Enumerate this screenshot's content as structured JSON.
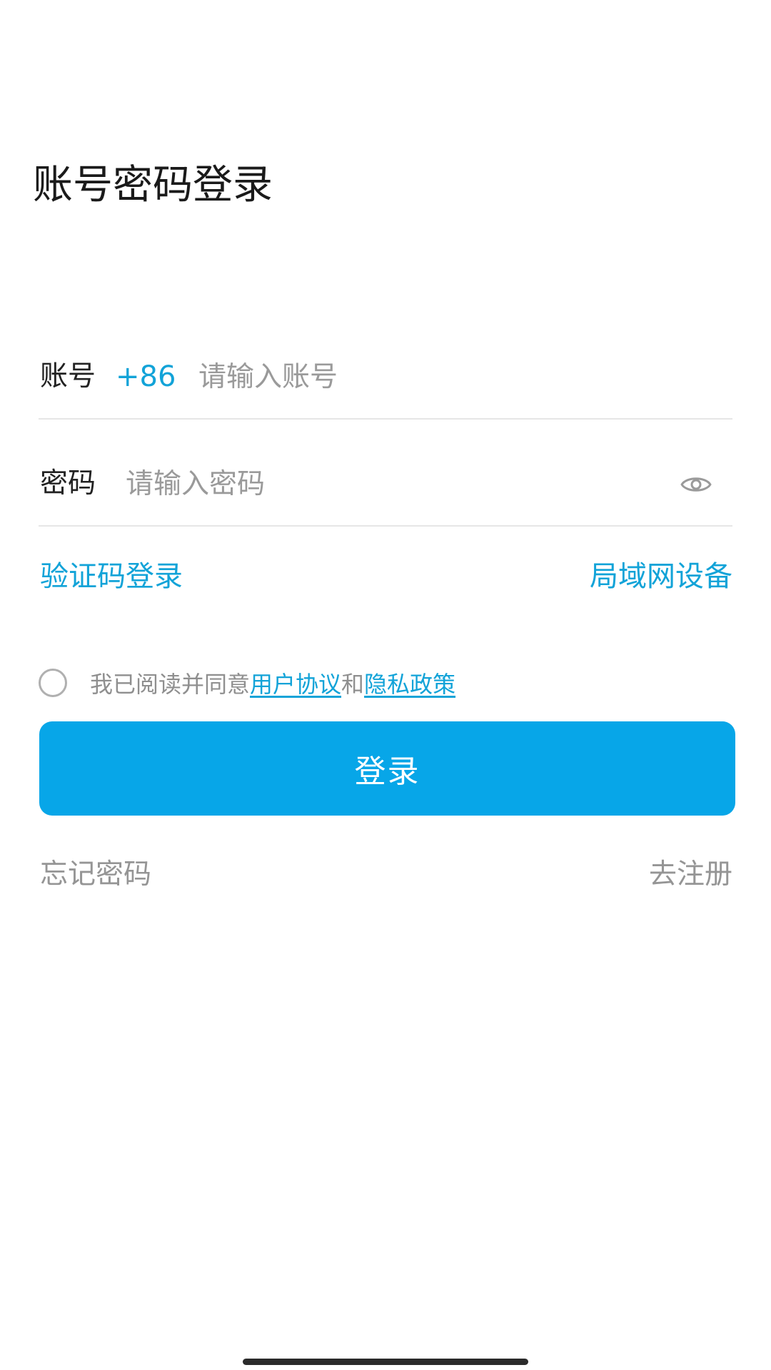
{
  "header": {
    "title": "账号密码登录"
  },
  "account": {
    "label": "账号",
    "country_code": "+86",
    "placeholder": "请输入账号",
    "value": ""
  },
  "password": {
    "label": "密码",
    "placeholder": "请输入密码",
    "value": "",
    "visibility_icon": "eye-icon"
  },
  "links": {
    "sms_login": "验证码登录",
    "lan_device": "局域网设备"
  },
  "agreement": {
    "checked": false,
    "prefix": "我已阅读并同意",
    "user_agreement": "用户协议",
    "and": "和",
    "privacy_policy": "隐私政策"
  },
  "login_button": {
    "label": "登录"
  },
  "footer": {
    "forgot_password": "忘记密码",
    "register": "去注册"
  },
  "colors": {
    "accent": "#07a6e8",
    "link": "#12a3d8",
    "muted_text": "#959595",
    "divider": "#e6e6e6"
  }
}
